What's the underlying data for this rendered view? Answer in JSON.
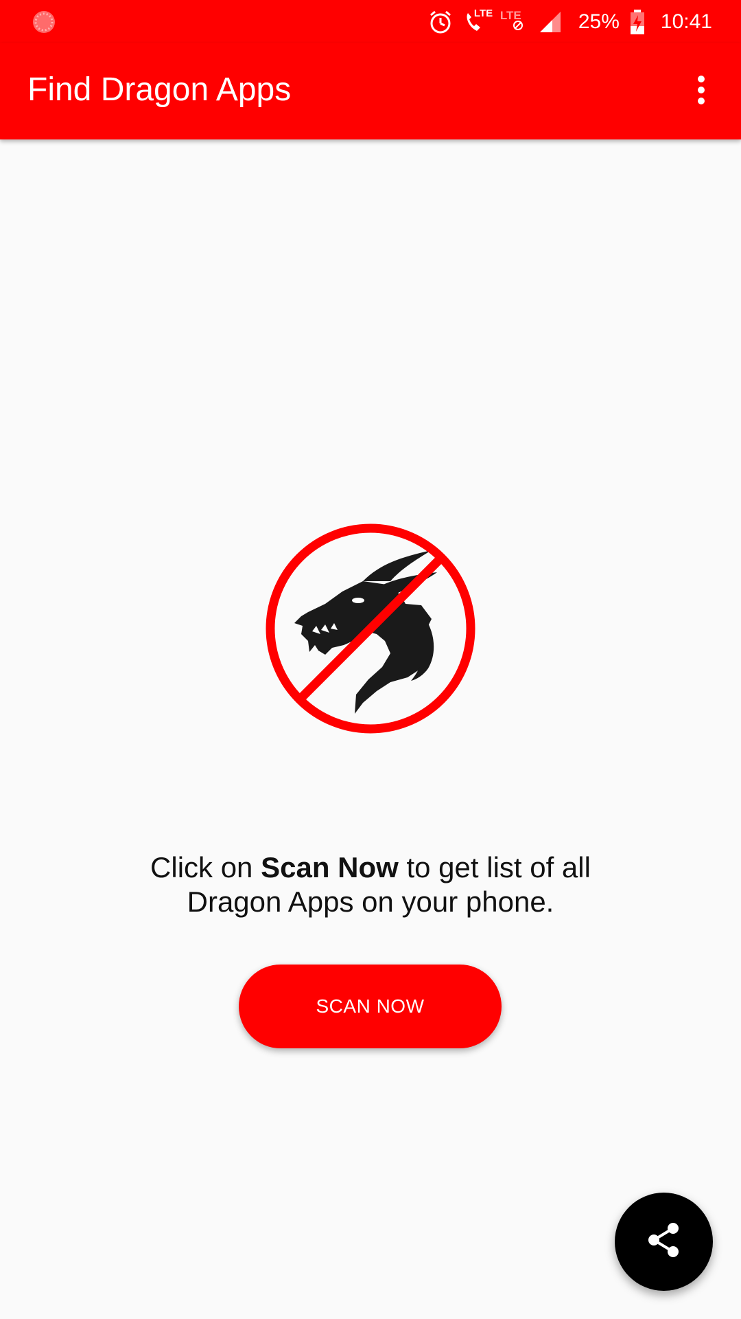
{
  "status_bar": {
    "battery_percent": "25%",
    "time": "10:41",
    "lte_label": "LTE",
    "lte_label_2": "LTE",
    "icons": [
      "record-icon",
      "alarm-icon",
      "call-lte-icon",
      "lte-data-icon",
      "signal-icon",
      "battery-charging-icon"
    ]
  },
  "app_bar": {
    "title": "Find Dragon Apps",
    "menu_icon": "more-vert-icon"
  },
  "main": {
    "hero_icon": "no-dragon-icon",
    "message": {
      "part1": "Click on ",
      "emphasis": "Scan Now",
      "part2": " to get list of all",
      "line2": "Dragon Apps on your phone."
    },
    "scan_button_label": "SCAN NOW"
  },
  "fab": {
    "icon": "share-icon"
  },
  "colors": {
    "primary": "#ff0000",
    "background": "#fafafa",
    "fab": "#000000",
    "text": "#111111"
  }
}
